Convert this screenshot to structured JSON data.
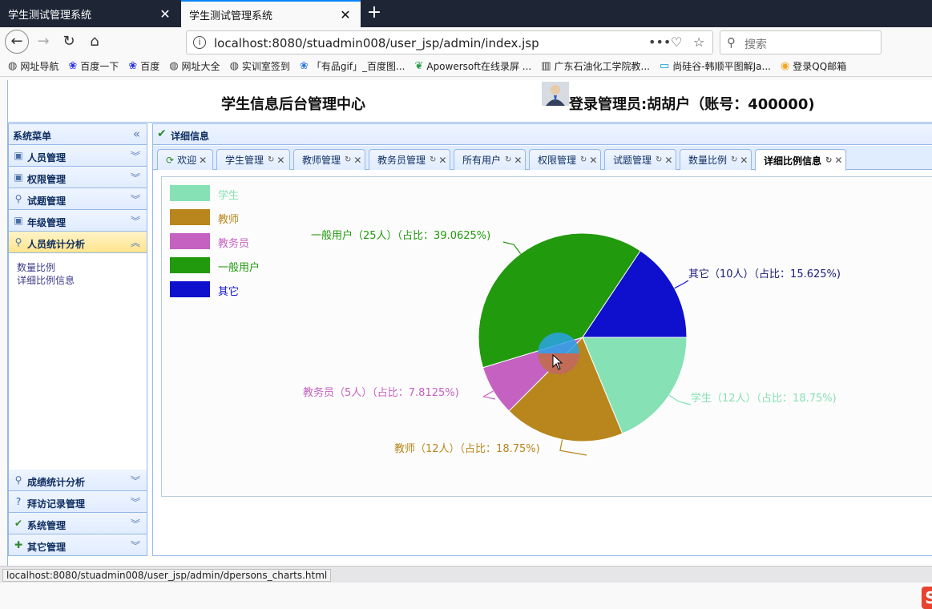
{
  "browser": {
    "tabs": [
      {
        "title": "学生测试管理系统",
        "active": false
      },
      {
        "title": "学生测试管理系统",
        "active": true
      }
    ],
    "url": "localhost:8080/stuadmin008/user_jsp/admin/index.jsp",
    "search_placeholder": "搜索",
    "bookmarks": [
      {
        "label": "网址导航",
        "icon": "globe-icon",
        "color": "#444444"
      },
      {
        "label": "百度一下",
        "icon": "baidu-icon",
        "color": "#2932e1"
      },
      {
        "label": "百度",
        "icon": "baidu-icon",
        "color": "#2932e1"
      },
      {
        "label": "网址大全",
        "icon": "globe-icon",
        "color": "#444444"
      },
      {
        "label": "实训室签到",
        "icon": "globe-icon",
        "color": "#444444"
      },
      {
        "label": "「有品gif」_百度图...",
        "icon": "paw-icon",
        "color": "#2f7be3"
      },
      {
        "label": "Apowersoft在线录屏 ...",
        "icon": "leaf-icon",
        "color": "#2aa04a"
      },
      {
        "label": "广东石油化工学院教...",
        "icon": "building-icon",
        "color": "#333333"
      },
      {
        "label": "尚硅谷-韩顺平图解Ja...",
        "icon": "bilibili-icon",
        "color": "#00a1d6"
      },
      {
        "label": "登录QQ邮箱",
        "icon": "qq-icon",
        "color": "#f5a623"
      }
    ],
    "status_url": "localhost:8080/stuadmin008/user_jsp/admin/dpersons_charts.html"
  },
  "header": {
    "title": "学生信息后台管理中心",
    "login_text": "登录管理员:胡胡户（账号：400000)"
  },
  "sidebar": {
    "title": "系统菜单",
    "collapse_icon": "double-chevron-left-icon",
    "top_items": [
      {
        "label": "人员管理",
        "icon": "save-icon"
      },
      {
        "label": "权限管理",
        "icon": "save-icon"
      },
      {
        "label": "试题管理",
        "icon": "search-icon"
      },
      {
        "label": "年级管理",
        "icon": "save-icon"
      },
      {
        "label": "人员统计分析",
        "icon": "search-icon",
        "selected": true
      }
    ],
    "sub_items": [
      "数量比例",
      "详细比例信息"
    ],
    "bottom_items": [
      {
        "label": "成绩统计分析",
        "icon": "search-icon"
      },
      {
        "label": "拜访记录管理",
        "icon": "help-icon"
      },
      {
        "label": "系统管理",
        "icon": "check-icon"
      },
      {
        "label": "其它管理",
        "icon": "plus-icon"
      }
    ]
  },
  "main": {
    "title": "详细信息",
    "tabs": [
      "欢迎",
      "学生管理",
      "教师管理",
      "教务员管理",
      "所有用户",
      "权限管理",
      "试题管理",
      "数量比例",
      "详细比例信息"
    ],
    "selected_tab": "详细比例信息"
  },
  "chart_data": {
    "type": "pie",
    "title": "",
    "legend_position": "top-left",
    "slices": [
      {
        "name": "学生",
        "value": 12,
        "percent": 18.75,
        "color": "#86e1b4",
        "label": "学生（12人）（占比：18.75%)"
      },
      {
        "name": "教师",
        "value": 12,
        "percent": 18.75,
        "color": "#b8861c",
        "label": "教师（12人）（占比：18.75%)"
      },
      {
        "name": "教务员",
        "value": 5,
        "percent": 7.8125,
        "color": "#c561c1",
        "label": "教务员（5人）（占比：7.8125%)"
      },
      {
        "name": "一般用户",
        "value": 25,
        "percent": 39.0625,
        "color": "#219a0d",
        "label": "一般用户（25人）（占比：39.0625%)"
      },
      {
        "name": "其它",
        "value": 10,
        "percent": 15.625,
        "color": "#0f0fce",
        "label": "其它（10人）（占比：15.625%)"
      }
    ]
  }
}
